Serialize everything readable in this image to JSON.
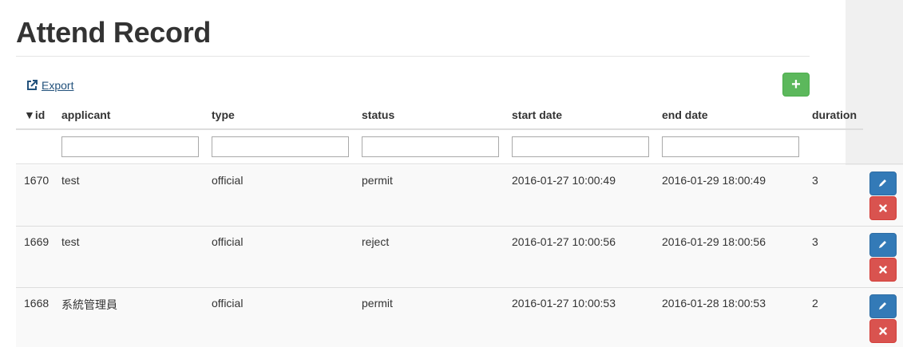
{
  "page": {
    "title": "Attend Record"
  },
  "toolbar": {
    "export_label": "Export",
    "export_icon": "external-link-icon",
    "add_icon": "plus-icon",
    "add_symbol": "+"
  },
  "table": {
    "sort_indicator": "▼",
    "columns": [
      {
        "key": "id",
        "label": "id"
      },
      {
        "key": "applicant",
        "label": "applicant"
      },
      {
        "key": "type",
        "label": "type"
      },
      {
        "key": "status",
        "label": "status"
      },
      {
        "key": "start_date",
        "label": "start date"
      },
      {
        "key": "end_date",
        "label": "end date"
      },
      {
        "key": "duration",
        "label": "duration"
      }
    ],
    "filters": {
      "applicant": "",
      "type": "",
      "status": "",
      "start_date": "",
      "end_date": ""
    },
    "rows": [
      {
        "id": "1670",
        "applicant": "test",
        "type": "official",
        "status": "permit",
        "start_date": "2016-01-27 10:00:49",
        "end_date": "2016-01-29 18:00:49",
        "duration": "3"
      },
      {
        "id": "1669",
        "applicant": "test",
        "type": "official",
        "status": "reject",
        "start_date": "2016-01-27 10:00:56",
        "end_date": "2016-01-29 18:00:56",
        "duration": "3"
      },
      {
        "id": "1668",
        "applicant": "系統管理員",
        "type": "official",
        "status": "permit",
        "start_date": "2016-01-27 10:00:53",
        "end_date": "2016-01-28 18:00:53",
        "duration": "2"
      }
    ],
    "row_actions": {
      "edit_icon": "pencil-icon",
      "delete_icon": "close-icon"
    }
  },
  "colors": {
    "add_button": "#5cb85c",
    "edit_button": "#337ab7",
    "delete_button": "#d9534f",
    "link": "#23527c"
  }
}
